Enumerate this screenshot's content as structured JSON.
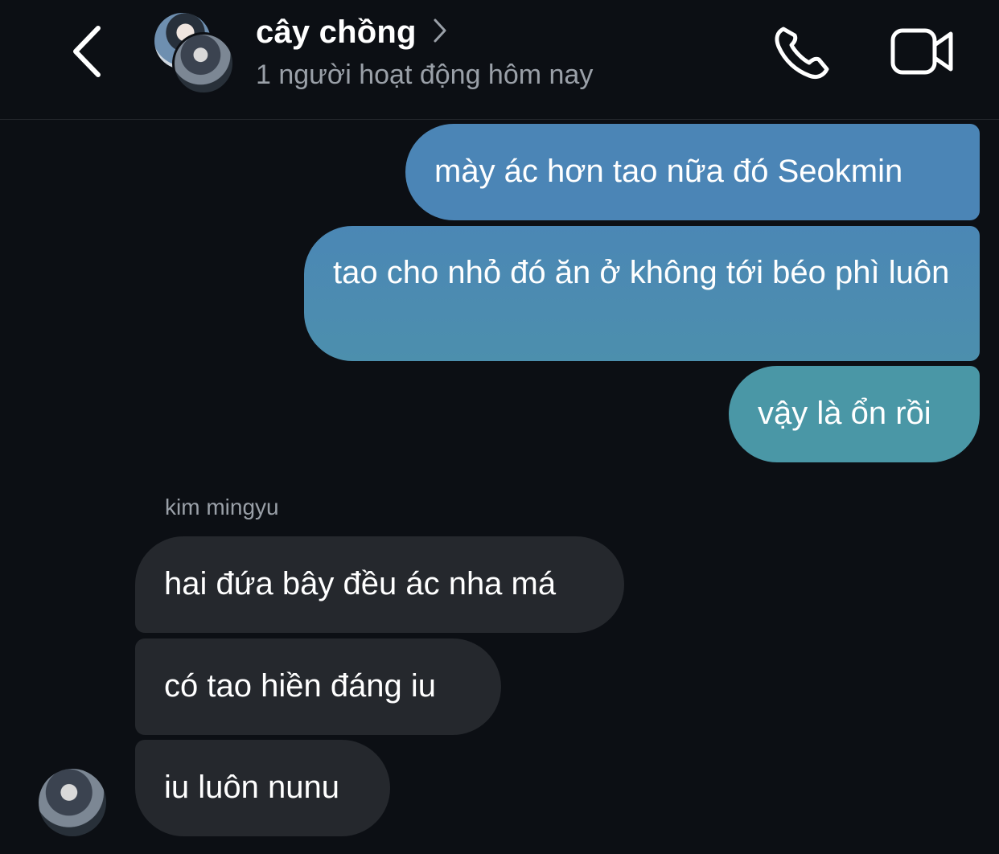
{
  "header": {
    "title": "cây chồng",
    "subtitle": "1 người hoạt động hôm nay"
  },
  "icons": {
    "back": "chevron-left-icon",
    "title_chevron": "chevron-right-icon",
    "call": "phone-icon",
    "video": "video-camera-icon"
  },
  "colors": {
    "background": "#0c0f14",
    "sent_top": "#4a7fb8",
    "sent_bottom": "#4a96a6",
    "received": "#25282d",
    "muted_text": "#9aa0a8"
  },
  "messages": [
    {
      "side": "sent",
      "text": "mày ác hơn tao nữa đó Seokmin"
    },
    {
      "side": "sent",
      "text": "tao cho nhỏ đó ăn ở không tới béo phì luôn"
    },
    {
      "side": "sent",
      "text": "vậy là ổn rồi"
    },
    {
      "side": "received",
      "sender": "kim mingyu",
      "text": "hai đứa bây đều ác nha má"
    },
    {
      "side": "received",
      "text": "có tao hiền đáng iu"
    },
    {
      "side": "received",
      "text": "iu luôn nunu"
    }
  ]
}
